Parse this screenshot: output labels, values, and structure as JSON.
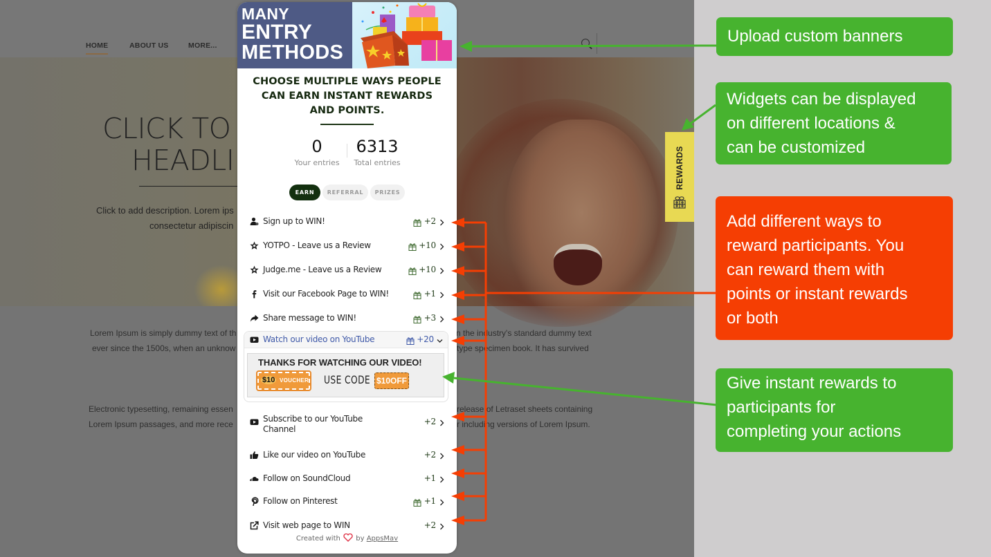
{
  "site": {
    "nav": [
      "HOME",
      "ABOUT US",
      "MORE..."
    ],
    "hero_title_lines": [
      "CLICK TO",
      "HEADLI"
    ],
    "hero_desc_lines": [
      "Click to add description. Lorem ips",
      "consectetur adipiscin"
    ],
    "paragraph1_left": [
      "Lorem Ipsum is simply dummy text of th",
      "ever since the 1500s, when an unknow"
    ],
    "paragraph1_right": [
      "n the industry's standard dummy text",
      "type specimen book. It has survived"
    ],
    "paragraph2_left": [
      "Electronic typesetting, remaining essen",
      "Lorem Ipsum passages, and more rece"
    ],
    "paragraph2_right": [
      "release of Letraset sheets containing",
      "r including versions of Lorem Ipsum."
    ]
  },
  "rewards_tab": {
    "label": "REWARDS",
    "icon": "gift-icon",
    "color": "#e8d953"
  },
  "widget": {
    "banner_lines": [
      "MANY",
      "ENTRY",
      "METHODS"
    ],
    "headline_lines": [
      "CHOOSE MULTIPLE WAYS PEOPLE",
      "CAN EARN INSTANT REWARDS",
      "AND POINTS."
    ],
    "stats": {
      "your_entries": "0",
      "your_entries_label": "Your entries",
      "total_entries": "6313",
      "total_entries_label": "Total entries"
    },
    "tabs": [
      {
        "label": "EARN",
        "active": true
      },
      {
        "label": "REFERRAL",
        "active": false
      },
      {
        "label": "PRIZES",
        "active": false
      }
    ],
    "actions": [
      {
        "icon": "user-icon",
        "label": "Sign up to WIN!",
        "points": "+2",
        "gift": true
      },
      {
        "icon": "star-icon",
        "label": "YOTPO - Leave us a Review",
        "points": "+10",
        "gift": true
      },
      {
        "icon": "star-icon",
        "label": "Judge.me - Leave us a Review",
        "points": "+10",
        "gift": true
      },
      {
        "icon": "facebook-icon",
        "label": "Visit our Facebook Page to WIN!",
        "points": "+1",
        "gift": true
      },
      {
        "icon": "share-icon",
        "label": "Share message to WIN!",
        "points": "+3",
        "gift": true
      },
      {
        "icon": "youtube-icon",
        "label": "Watch our video on YouTube",
        "points": "+20",
        "gift": true,
        "expanded": true
      },
      {
        "icon": "youtube-icon",
        "label": "Subscribe to our YouTube Channel",
        "points": "+2",
        "gift": false
      },
      {
        "icon": "thumbs-up-icon",
        "label": "Like our video on YouTube",
        "points": "+2",
        "gift": false
      },
      {
        "icon": "soundcloud-icon",
        "label": "Follow on SoundCloud",
        "points": "+1",
        "gift": false
      },
      {
        "icon": "pinterest-icon",
        "label": "Follow on Pinterest",
        "points": "+1",
        "gift": true
      },
      {
        "icon": "external-link-icon",
        "label": "Visit web page to WIN",
        "points": "+2",
        "gift": false
      }
    ],
    "reward_banner": {
      "title": "THANKS FOR WATCHING OUR VIDEO!",
      "voucher_amount": "$10",
      "voucher_text": "VOUCHER",
      "use_code": "USE CODE",
      "code": "$10OFF"
    },
    "footer": {
      "prefix": "Created with",
      "by": "by",
      "brand": "AppsMav"
    }
  },
  "callouts": {
    "banners": {
      "lines": [
        "Upload custom banners"
      ],
      "color": "#47b32f"
    },
    "widgets": {
      "lines": [
        "Widgets can be displayed",
        "on different locations &",
        "can be customized"
      ],
      "color": "#47b32f"
    },
    "ways": {
      "lines": [
        "Add different ways to",
        "reward participants. You",
        "can reward them with",
        "points or instant rewards",
        "or both"
      ],
      "color": "#f53e03"
    },
    "instant": {
      "lines": [
        "Give instant rewards to",
        "participants for",
        "completing your actions"
      ],
      "color": "#47b32f"
    }
  }
}
